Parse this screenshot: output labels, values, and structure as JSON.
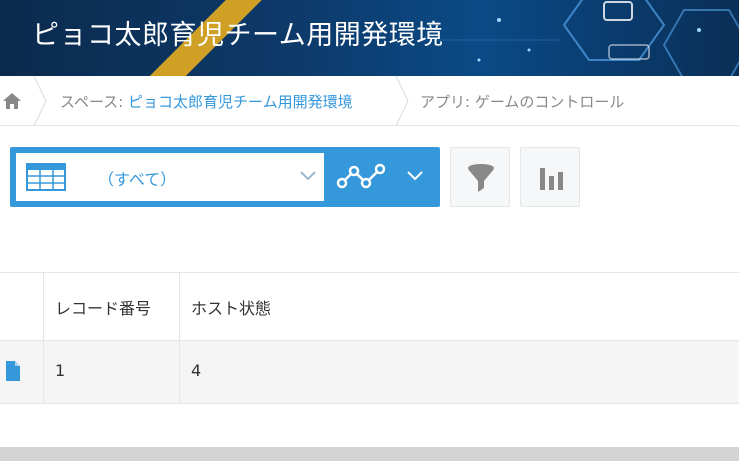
{
  "banner": {
    "title": "ピョコ太郎育児チーム用開発環境"
  },
  "breadcrumb": {
    "home_icon": "home-icon",
    "space_prefix": "スペース: ",
    "space_name": "ピョコ太郎育児チーム用開発環境",
    "app_label": "アプリ: ゲームのコントロール"
  },
  "toolbar": {
    "view_label": "（すべて）",
    "view_icon": "table-view-icon",
    "graph_icon": "line-graph-icon",
    "filter_icon": "filter-icon",
    "chart_icon": "bar-chart-icon"
  },
  "table": {
    "columns": [
      "レコード番号",
      "ホスト状態"
    ],
    "rows": [
      {
        "record_number": "1",
        "host_state": "4"
      }
    ]
  },
  "colors": {
    "accent": "#3498db",
    "banner_dark": "#0b2a4d",
    "stripe": "#f2b31b",
    "border": "#e3e7e8"
  }
}
